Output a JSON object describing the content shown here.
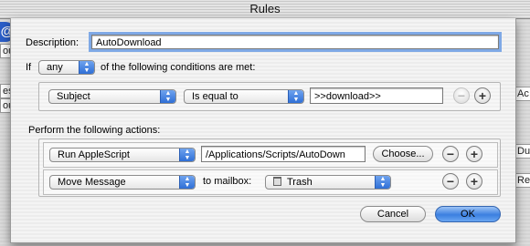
{
  "window": {
    "title": "Rules"
  },
  "background": {
    "left_fragments": [
      "ou",
      "es",
      "ou"
    ],
    "right_fragments": [
      "Ac",
      "Du",
      "Re"
    ]
  },
  "description": {
    "label": "Description:",
    "value": "AutoDownload"
  },
  "match": {
    "prefix": "If",
    "selected": "any",
    "suffix": "of the following conditions are met:"
  },
  "condition": {
    "field": "Subject",
    "operator": "Is equal to",
    "value": ">>download>>"
  },
  "actions_label": "Perform the following actions:",
  "actions": [
    {
      "type": "Run AppleScript",
      "path": "/Applications/Scripts/AutoDown",
      "button": "Choose..."
    },
    {
      "type": "Move Message",
      "connector": "to mailbox:",
      "mailbox": "Trash"
    }
  ],
  "buttons": {
    "cancel": "Cancel",
    "ok": "OK",
    "minus": "−",
    "plus": "+"
  },
  "colors": {
    "accent": "#3b7fe0",
    "focus": "#7fa9e6"
  },
  "icons": {
    "mailbox": "trash-icon",
    "app": "at-icon"
  }
}
